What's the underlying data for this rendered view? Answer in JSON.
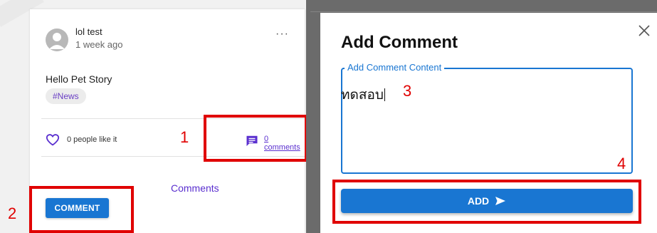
{
  "post": {
    "author": "lol test",
    "time_ago": "1 week ago",
    "more_label": "···",
    "text": "Hello Pet Story",
    "tag": "#News",
    "likes_label": "0 people like it",
    "comments_link": "0 comments",
    "comments_heading": "Comments",
    "comment_button": "COMMENT"
  },
  "dialog": {
    "title": "Add Comment",
    "field_label": "Add Comment Content",
    "field_value": "ทดสอบ",
    "add_button": "ADD"
  },
  "annotations": {
    "step1": "1",
    "step2": "2",
    "step3": "3",
    "step4": "4",
    "color": "#e00000"
  },
  "colors": {
    "primary": "#1976d2",
    "purple": "#5a2fcf",
    "tag_text": "#6a3fc4"
  },
  "icons": {
    "avatar": "avatar-icon",
    "like": "heart-outline-icon",
    "comment": "comment-icon",
    "close": "close-icon",
    "send": "send-icon",
    "more": "more-horizontal-icon"
  }
}
